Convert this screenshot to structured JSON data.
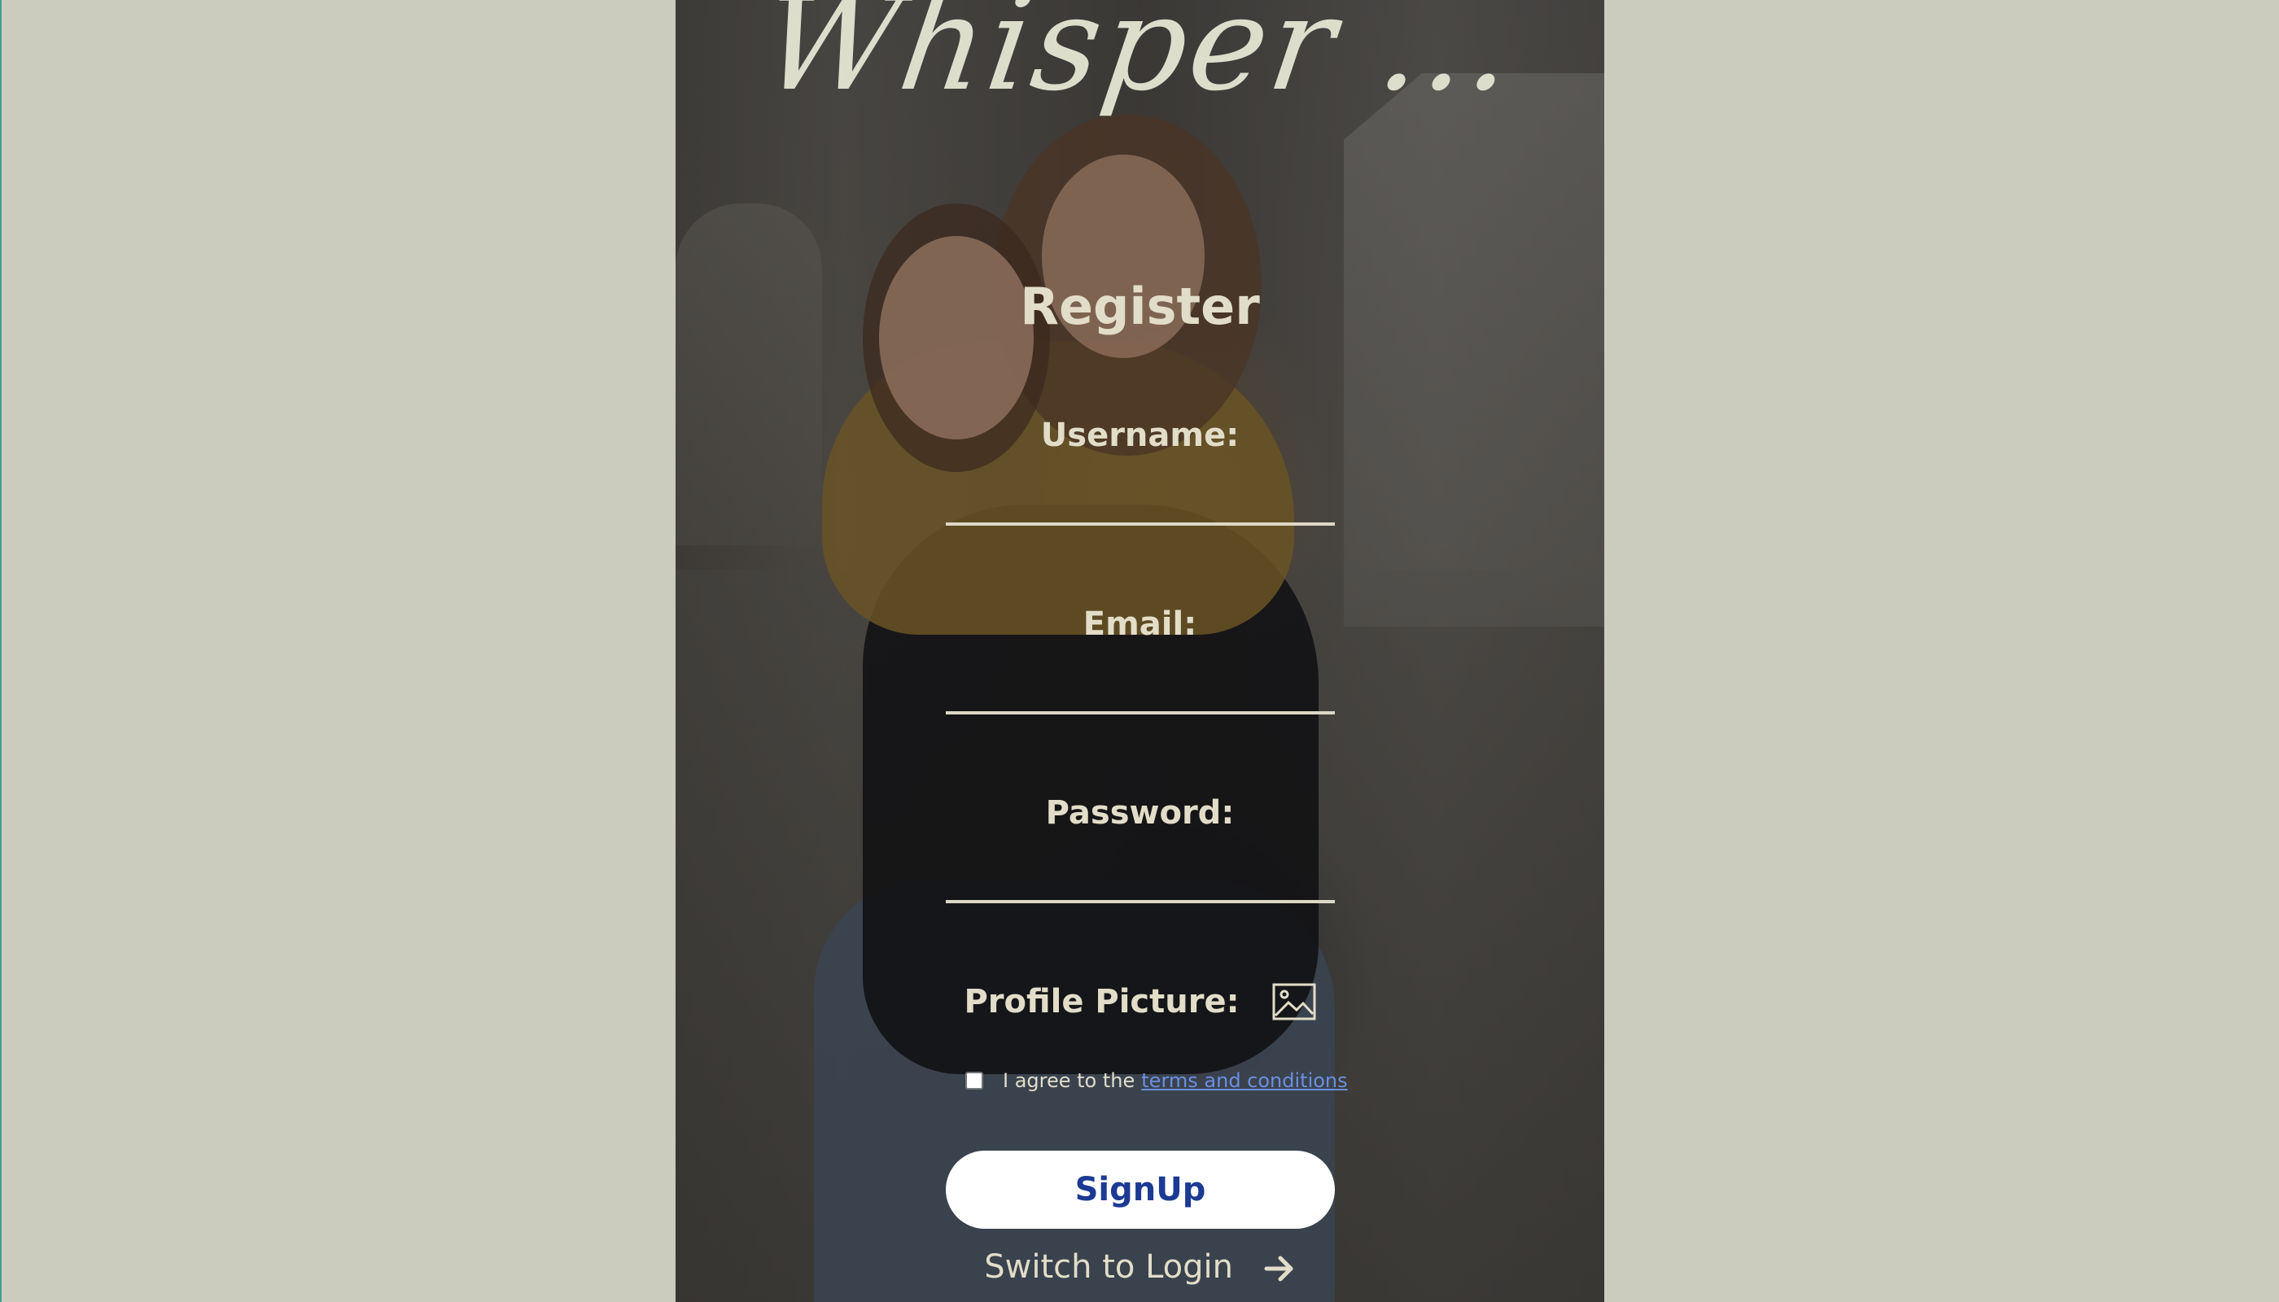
{
  "app": {
    "logo_text": "Whisper ..."
  },
  "form": {
    "title": "Register",
    "username_label": "Username:",
    "username_value": "",
    "email_label": "Email:",
    "email_value": "",
    "password_label": "Password:",
    "password_value": "",
    "profile_picture_label": "Profile Picture:",
    "profile_picture_icon": "image-icon",
    "terms_prefix": "I agree to the",
    "terms_link": "terms and conditions",
    "terms_checked": false,
    "signup_label": "SignUp",
    "switch_label": "Switch to Login",
    "switch_icon": "arrow-right-icon"
  },
  "colors": {
    "page_background": "#cbccbe",
    "text": "#e2ddc8",
    "link": "#6b8fe0",
    "button_text": "#1c3a93",
    "button_bg": "#ffffff"
  }
}
